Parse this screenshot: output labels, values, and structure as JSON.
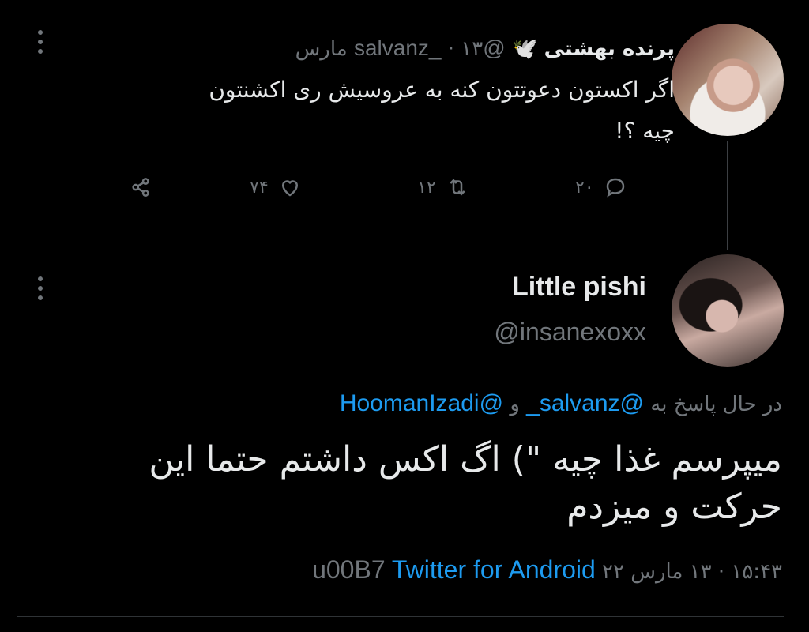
{
  "tweet1": {
    "display_name": "پرنده بهشتی",
    "emoji": "🕊️",
    "handle": "@salvanz_",
    "separator": "·",
    "date": "۱۳ مارس",
    "text_line1": "اگر اکستون دعوتتون کنه به عروسیش ری اکشنتون",
    "text_line2": "چیه ؟!",
    "replies": "۲۰",
    "retweets": "۱۲",
    "likes": "۷۴"
  },
  "tweet2": {
    "display_name": "Little pishi",
    "handle": "@insanexoxx",
    "reply_prefix": "در حال پاسخ به",
    "reply_user1": "@salvanz_",
    "reply_joiner": "و",
    "reply_user2": "@HoomanIzadi",
    "text_line1": "میپرسم غذا چیه \") اگ اکس داشتم حتما این",
    "text_line2": "حرکت و میزدم",
    "time": "۱۵:۴۳",
    "date": "۱۳ مارس ۲۲",
    "separator": "·",
    "client_code": "u00B7",
    "client": "Twitter for Android"
  },
  "icons": {
    "reply": "reply-icon",
    "retweet": "retweet-icon",
    "like": "heart-icon",
    "share": "share-icon",
    "more": "more-vertical-icon"
  }
}
